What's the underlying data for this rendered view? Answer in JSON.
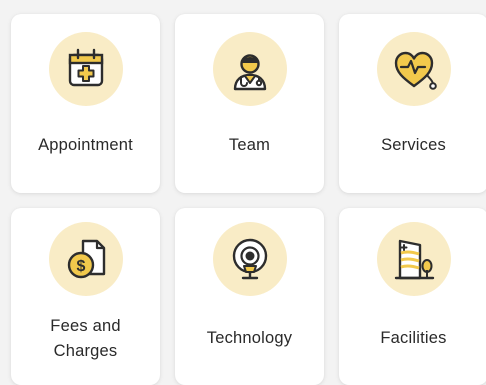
{
  "grid": {
    "items": [
      {
        "label": "Appointment",
        "icon": "calendar-plus-icon"
      },
      {
        "label": "Team",
        "icon": "doctor-icon"
      },
      {
        "label": "Services",
        "icon": "heart-stethoscope-icon"
      },
      {
        "label_line1": "Fees and",
        "label_line2": "Charges",
        "icon": "money-document-icon"
      },
      {
        "label": "Technology",
        "icon": "mri-scanner-icon"
      },
      {
        "label": "Facilities",
        "icon": "hospital-building-icon"
      }
    ]
  },
  "colors": {
    "icon_bg": "#f9ecc6",
    "accent_yellow": "#f2c94c",
    "outline": "#2d2d2d",
    "card_bg": "#ffffff",
    "page_bg": "#f3f3f3"
  }
}
